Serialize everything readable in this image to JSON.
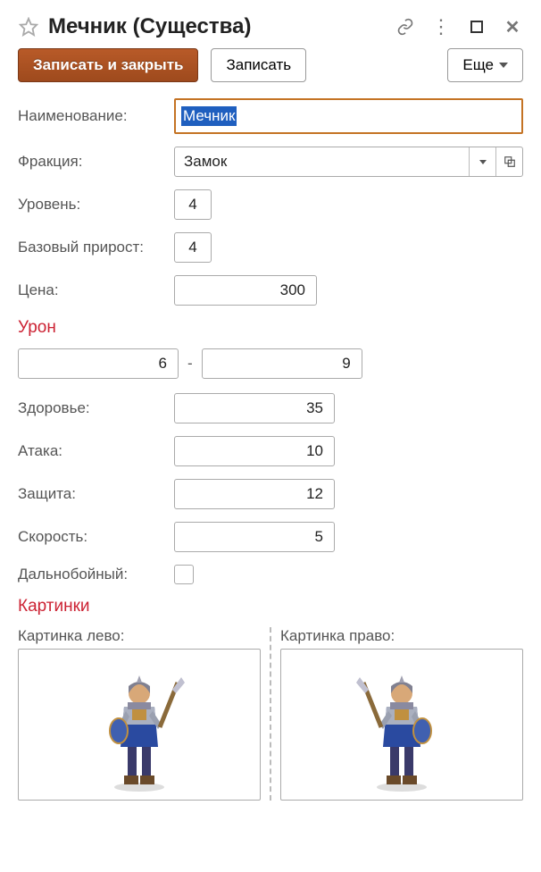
{
  "window": {
    "title": "Мечник (Существа)"
  },
  "toolbar": {
    "save_close": "Записать и закрыть",
    "save": "Записать",
    "more": "Еще"
  },
  "fields": {
    "name_label": "Наименование:",
    "name_value": "Мечник",
    "faction_label": "Фракция:",
    "faction_value": "Замок",
    "level_label": "Уровень:",
    "level_value": "4",
    "growth_label": "Базовый прирост:",
    "growth_value": "4",
    "price_label": "Цена:",
    "price_value": "300"
  },
  "damage": {
    "section": "Урон",
    "min": "6",
    "max": "9"
  },
  "stats": {
    "health_label": "Здоровье:",
    "health_value": "35",
    "attack_label": "Атака:",
    "attack_value": "10",
    "defense_label": "Защита:",
    "defense_value": "12",
    "speed_label": "Скорость:",
    "speed_value": "5",
    "ranged_label": "Дальнобойный:",
    "ranged_checked": false
  },
  "pictures": {
    "section": "Картинки",
    "left_label": "Картинка лево:",
    "right_label": "Картинка право:"
  }
}
